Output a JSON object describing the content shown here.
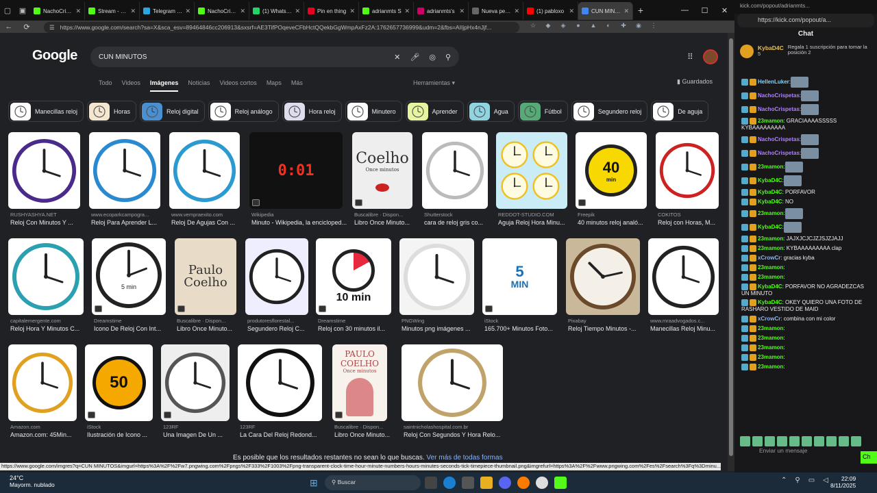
{
  "browser": {
    "tabs": [
      {
        "label": "NachoCrispe",
        "color": "#53fc18",
        "active": false
      },
      {
        "label": "Stream - Kic",
        "color": "#53fc18",
        "active": false
      },
      {
        "label": "Telegram Wi",
        "color": "#2aa5e0",
        "active": false
      },
      {
        "label": "NachoCrispe",
        "color": "#53fc18",
        "active": false
      },
      {
        "label": "(1) WhatsAp",
        "color": "#25d366",
        "active": false
      },
      {
        "label": "Pin en thing",
        "color": "#e60023",
        "active": false
      },
      {
        "label": "adrianmts S",
        "color": "#53fc18",
        "active": false
      },
      {
        "label": "adrianmts's",
        "color": "#c06",
        "active": false
      },
      {
        "label": "Nueva pesta",
        "color": "#666",
        "active": false
      },
      {
        "label": "(1) pabloxo",
        "color": "#f00",
        "active": false
      },
      {
        "label": "CUN MINUTO",
        "color": "#4285f4",
        "active": true
      }
    ],
    "tab_close": "✕",
    "new_tab": "+",
    "url": "https://www.google.com/search?sa=X&sca_esv=89464846cc206913&sxsrf=AE3TifPOqeveCFbHctQQekbGgWmpAxFz2A:1762657736999&udm=2&fbs=AIIjpHx4nJjf..."
  },
  "google": {
    "logo": "Google",
    "query": "CUN MINUTOS",
    "nav": [
      "Todo",
      "Videos",
      "Imágenes",
      "Noticias",
      "Videos cortos",
      "Maps",
      "Más"
    ],
    "active_nav": "Imágenes",
    "tools": "Herramientas",
    "saved": "Guardados",
    "chips": [
      "Manecillas reloj",
      "Horas",
      "Reloj digital",
      "Reloj análogo",
      "Hora reloj",
      "Minutero",
      "Aprender",
      "Agua",
      "Fútbol",
      "Segundero reloj",
      "De aguja"
    ],
    "results": [
      {
        "src": "RUSHYASHYA.NET",
        "title": "Reloj Con Minutos Y ..."
      },
      {
        "src": "www.ecoparkcampogra...",
        "title": "Reloj Para Aprender L..."
      },
      {
        "src": "www.vempraexito.com",
        "title": "Reloj De Agujas Con ..."
      },
      {
        "src": "Wikipedia",
        "title": "Minuto - Wikipedia, la encicloped..."
      },
      {
        "src": "Buscalibre · Dispon...",
        "title": "Libro Once Minuto..."
      },
      {
        "src": "Shutterstock",
        "title": "cara de reloj gris co..."
      },
      {
        "src": "REDDOT-STUDIO.COM",
        "title": "Aguja Reloj Hora Minu..."
      },
      {
        "src": "Freepik",
        "title": "40 minutos reloj analó..."
      },
      {
        "src": "COKITOS",
        "title": "Reloj con Horas, M..."
      },
      {
        "src": "capitalemergente.com",
        "title": "Reloj Hora Y Minutos C..."
      },
      {
        "src": "Dreamstime",
        "title": "Icono De Reloj Con Int..."
      },
      {
        "src": "Buscalibre · Dispon...",
        "title": "Libro Once Minuto..."
      },
      {
        "src": "produtoresflorestal...",
        "title": "Segundero Reloj C..."
      },
      {
        "src": "Dreamstime",
        "title": "Reloj con 30 minutos il..."
      },
      {
        "src": "PNGWing",
        "title": "Minutos png imágenes ..."
      },
      {
        "src": "iStock",
        "title": "165.700+ Minutos Foto..."
      },
      {
        "src": "Pixabay",
        "title": "Reloj Tiempo Minutos -..."
      },
      {
        "src": "www.mraadvogados.c...",
        "title": "Manecillas Reloj Minu..."
      },
      {
        "src": "Amazon.com",
        "title": "Amazon.com: 45Min..."
      },
      {
        "src": "iStock",
        "title": "Ilustración de Icono ..."
      },
      {
        "src": "123RF",
        "title": "Una Imagen De Un ..."
      },
      {
        "src": "123RF",
        "title": "La Cara Del Reloj Redond..."
      },
      {
        "src": "Buscalibre · Dispon...",
        "title": "Libro Once Minuto..."
      },
      {
        "src": "saintnicholashospital.com.br",
        "title": "Reloj Con Segundos Y Hora Relo..."
      }
    ],
    "image_texts": {
      "digital": "0:01",
      "coelho1": "Coelho",
      "coelho1_sub": "Once minutos",
      "forty": "40",
      "forty_unit": "min",
      "five_min": "5 min",
      "paulo": "Paulo Coelho",
      "ten_min": "10 min",
      "five": "5",
      "five_unit": "MIN",
      "fifty": "50",
      "coelho3": "PAULO COELHO",
      "coelho3_sub": "Once minutos"
    },
    "footer_text": "Es posible que los resultados restantes no sean lo que buscas.",
    "footer_link": "Ver más de todas formas",
    "status_url": "https://www.google.com/imgres?q=CUN MINUTOS&imgurl=https%3A%2F%2Fw7.pngwing.com%2Fpngs%2F333%2F1003%2Fpng-transparent-clock-time-hour-minute-numbers-hours-minutes-seconds-tick-timepiece-thumbnail.png&imgrefurl=https%3A%2F%2Fwww.pngwing.com%2Fes%2Fsearch%3Fq%3Dminu..."
  },
  "kick": {
    "top": "kick.com/popout/adrianmts...",
    "url": "https://kick.com/popout/a...",
    "title": "Chat",
    "pin_user": "KybaD4C",
    "pin_count": "5",
    "pin_msg": "Regala 1 suscripción para tomar la posición 2",
    "messages": [
      {
        "user": "HellenLuker",
        "color": "#7fd3ff",
        "text": ":",
        "emote": true
      },
      {
        "user": "NachoCrispetas",
        "color": "#b07fff",
        "text": ":",
        "emote": true
      },
      {
        "user": "NachoCrispetas",
        "color": "#b07fff",
        "text": ":",
        "emote": true
      },
      {
        "user": "23mamon",
        "color": "#53fc18",
        "text": ": GRACIAAAASSSSS KYBAAAAAAAAA",
        "emote": false
      },
      {
        "user": "NachoCrispetas",
        "color": "#b07fff",
        "text": ":",
        "emote": true
      },
      {
        "user": "NachoCrispetas",
        "color": "#b07fff",
        "text": ":",
        "emote": true
      },
      {
        "user": "23mamon",
        "color": "#53fc18",
        "text": ":",
        "emote": true
      },
      {
        "user": "KybaD4C",
        "color": "#53fc18",
        "text": ":",
        "emote": true
      },
      {
        "user": "KybaD4C",
        "color": "#53fc18",
        "text": ": PORFAVOR",
        "emote": false
      },
      {
        "user": "KybaD4C",
        "color": "#53fc18",
        "text": ": NO",
        "emote": false
      },
      {
        "user": "23mamon",
        "color": "#53fc18",
        "text": ":",
        "emote": true
      },
      {
        "user": "KybaD4C",
        "color": "#53fc18",
        "text": ":",
        "emote": true
      },
      {
        "user": "23mamon",
        "color": "#53fc18",
        "text": ": JAJXJCJCJZJSJZJAJJ",
        "emote": false
      },
      {
        "user": "23mamon",
        "color": "#53fc18",
        "text": ": KYBAAAAAAAAA clap",
        "emote": false
      },
      {
        "user": "xCrowCr",
        "color": "#8ab4f8",
        "text": ": gracias kyba",
        "emote": false
      },
      {
        "user": "23mamon",
        "color": "#53fc18",
        "text": ":",
        "emote": false
      },
      {
        "user": "23mamon",
        "color": "#53fc18",
        "text": ":",
        "emote": false
      },
      {
        "user": "KybaD4C",
        "color": "#53fc18",
        "text": ": PORFAVOR NO AGRADEZCAS UN MINUTO",
        "emote": false
      },
      {
        "user": "KybaD4C",
        "color": "#53fc18",
        "text": ": OKEY QUIERO UNA FOTO DE RASHARO VESTIDO DE MAID",
        "emote": false
      },
      {
        "user": "xCrowCr",
        "color": "#8ab4f8",
        "text": ": combina con mi color",
        "emote": false
      },
      {
        "user": "23mamon",
        "color": "#53fc18",
        "text": ":",
        "emote": false
      },
      {
        "user": "23mamon",
        "color": "#53fc18",
        "text": ":",
        "emote": false
      },
      {
        "user": "23mamon",
        "color": "#53fc18",
        "text": ":",
        "emote": false
      },
      {
        "user": "23mamon",
        "color": "#53fc18",
        "text": ":",
        "emote": false
      },
      {
        "user": "23mamon",
        "color": "#53fc18",
        "text": ":",
        "emote": false
      }
    ],
    "send_placeholder": "Enviar un mensaje",
    "chat_button": "Ch"
  },
  "taskbar": {
    "temp": "24°C",
    "weather": "Mayorm. nublado",
    "search": "Buscar",
    "time": "22:09",
    "date": "8/11/2025"
  }
}
